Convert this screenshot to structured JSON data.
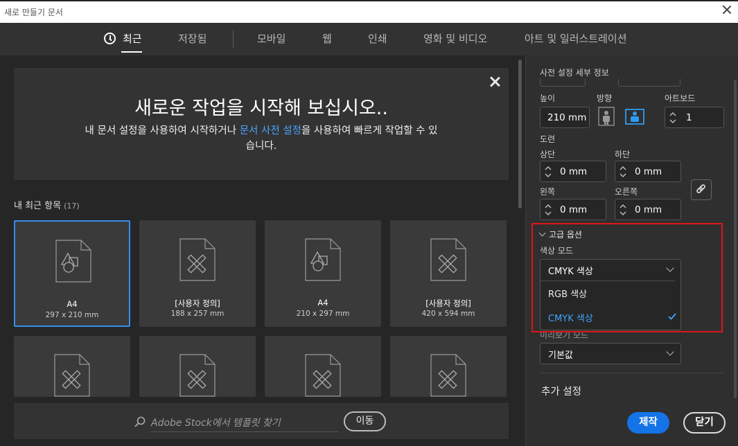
{
  "window": {
    "title": "새로 만들기 문서"
  },
  "tabs": [
    {
      "label": "최근",
      "active": true
    },
    {
      "label": "저장됨"
    },
    {
      "label": "모바일"
    },
    {
      "label": "웹"
    },
    {
      "label": "인쇄"
    },
    {
      "label": "영화 및 비디오"
    },
    {
      "label": "아트 및 일러스트레이션"
    }
  ],
  "hero": {
    "title": "새로운 작업을 시작해 보십시오..",
    "text_before": "내 문서 설정을 사용하여 시작하거나 ",
    "link": "문서 사전 설정",
    "text_after": "을 사용하여 빠르게 작업할 수 있습니다."
  },
  "recent": {
    "title": "내 최근 항목",
    "count": "(17)",
    "items": [
      {
        "name": "A4",
        "size": "297 x 210 mm",
        "icon": "shapes-doc-icon",
        "selected": true
      },
      {
        "name": "[사용자 정의]",
        "size": "188 x 257 mm",
        "icon": "ruler-pencil-doc-icon"
      },
      {
        "name": "A4",
        "size": "210 x 297 mm",
        "icon": "shapes-doc-icon"
      },
      {
        "name": "[사용자 정의]",
        "size": "420 x 594 mm",
        "icon": "ruler-pencil-doc-icon"
      },
      {
        "name": "",
        "size": "",
        "icon": "ruler-pencil-doc-icon"
      },
      {
        "name": "",
        "size": "",
        "icon": "ruler-pencil-doc-icon"
      },
      {
        "name": "",
        "size": "",
        "icon": "ruler-pencil-doc-icon"
      },
      {
        "name": "",
        "size": "",
        "icon": "ruler-pencil-doc-icon"
      }
    ]
  },
  "stock": {
    "placeholder": "Adobe Stock에서 템플릿 찾기",
    "go_label": "이동"
  },
  "preset": {
    "section_label": "사전 설정 세부 정보",
    "height_label": "높이",
    "height_value": "210 mm",
    "orientation_label": "방향",
    "artboard_label": "아트보드",
    "artboard_value": "1",
    "bleed_label": "도련",
    "top_label": "상단",
    "top_value": "0 mm",
    "bottom_label": "하단",
    "bottom_value": "0 mm",
    "left_label": "왼쪽",
    "left_value": "0 mm",
    "right_label": "오른쪽",
    "right_value": "0 mm"
  },
  "advanced": {
    "label": "고급 옵션",
    "color_mode_label": "색상 모드",
    "color_mode_value": "CMYK 색상",
    "options": [
      "RGB 색상",
      "CMYK 색상"
    ],
    "selected_option": "CMYK 색상",
    "preview_label": "미리보기 모드",
    "preview_value": "기본값"
  },
  "more_settings": "추가 설정",
  "buttons": {
    "create": "제작",
    "close": "닫기"
  },
  "colors": {
    "accent": "#1473e6",
    "link": "#4da3ff",
    "highlight": "#e0161b"
  }
}
